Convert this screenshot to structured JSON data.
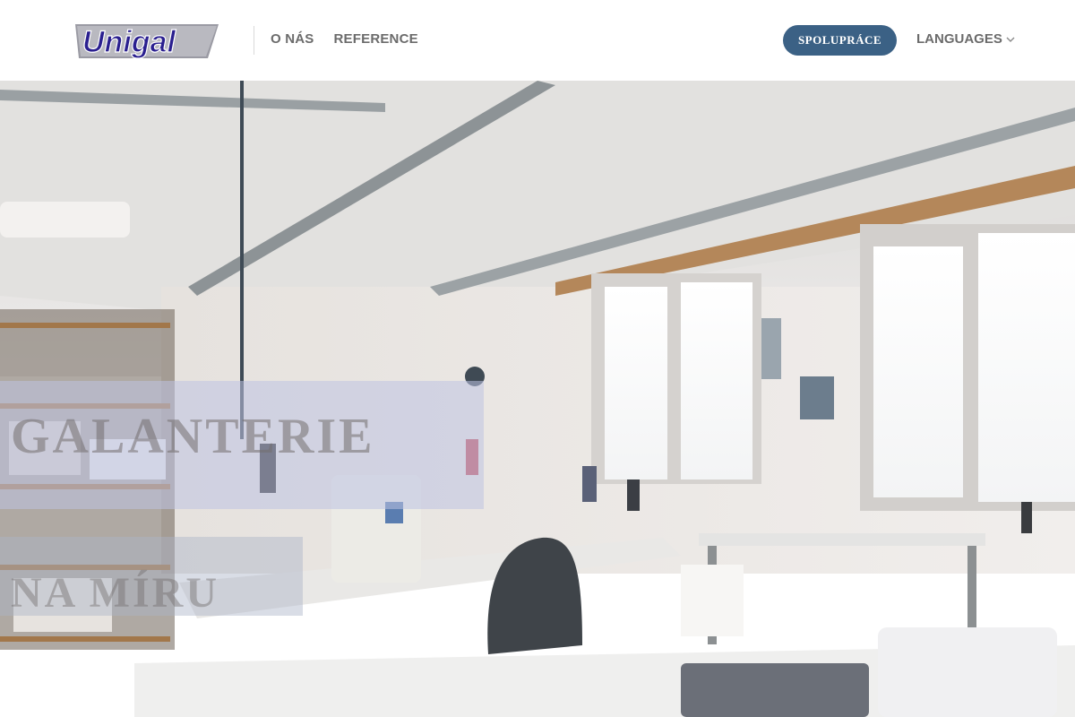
{
  "brand": {
    "logo_text": "Unigal"
  },
  "nav": {
    "items": [
      {
        "label": "O NÁS"
      },
      {
        "label": "REFERENCE"
      }
    ]
  },
  "cta": {
    "label": "SPOLUPRÁCE"
  },
  "languages": {
    "label": "LANGUAGES",
    "icon": "chevron-down-icon"
  },
  "hero": {
    "title": "GALANTERIE",
    "subtitle": "NA MÍRU",
    "image_alt": "sewing workshop"
  },
  "colors": {
    "accent": "#3b6185",
    "logo_blue": "#2a1f8f",
    "nav_text": "#6b6b6b"
  }
}
